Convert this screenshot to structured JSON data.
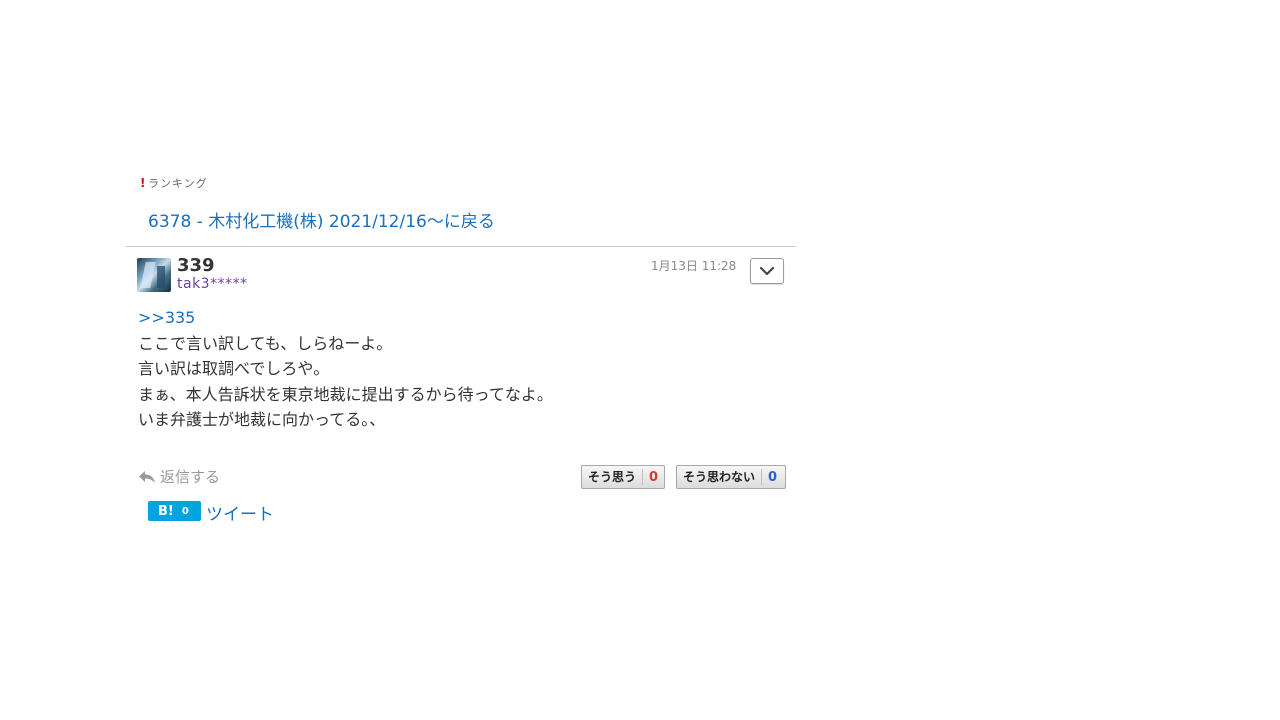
{
  "ranking": {
    "icon": "ranking-crown-icon",
    "label": "ランキング"
  },
  "navigation": {
    "back_link": "6378 - 木村化工機(株) 2021/12/16〜に戻る"
  },
  "post": {
    "number": "339",
    "username": "tak3*****",
    "timestamp": "1月13日 11:28",
    "reply_to": ">>335",
    "body_lines": [
      "ここで言い訳しても、しらねーよ。",
      "言い訳は取調べでしろや。",
      "まぁ、本人告訴状を東京地裁に提出するから待ってなよ。",
      "いま弁護士が地裁に向かってる。、"
    ]
  },
  "actions": {
    "reply_label": "返信する",
    "agree_label": "そう思う",
    "agree_count": "0",
    "disagree_label": "そう思わない",
    "disagree_count": "0"
  },
  "share": {
    "hatena_mark": "B!",
    "hatena_count": "0",
    "tweet_label": "ツイート"
  },
  "colors": {
    "link": "#1a6fbe",
    "username": "#6c3fa3",
    "agree_count": "#d23c2a",
    "disagree_count": "#2a5fd2",
    "hatena_bg": "#00a4de"
  }
}
